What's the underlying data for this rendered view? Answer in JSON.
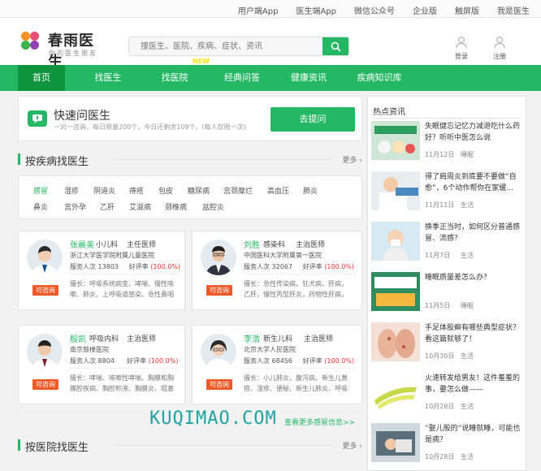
{
  "topbar": {
    "links": [
      "用户端App",
      "医生端App",
      "微信公众号",
      "企业版",
      "触屏版",
      "我是医生"
    ]
  },
  "logo": {
    "name": "春雨医生",
    "slogan": "你的医生朋友"
  },
  "search": {
    "placeholder": "搜医生、医院、疾病、症状、资讯"
  },
  "header": {
    "login": "登录",
    "register": "注册"
  },
  "nav": {
    "items": [
      "首页",
      "找医生",
      "找医院",
      "经典问答",
      "健康资讯",
      "疾病知识库"
    ],
    "new_badge": "NEW"
  },
  "quick": {
    "title": "快速问医生",
    "subtitle": "一对一咨询，每日限量200个，今日还剩余109个。(每人仅限一次)",
    "button": "去提问"
  },
  "disease_section": {
    "title": "按疾病找医生",
    "more": "更多"
  },
  "diseases": [
    "感冒",
    "湿疹",
    "阴道炎",
    "痔疮",
    "包皮",
    "糖尿病",
    "宫颈糜烂",
    "高血压",
    "肺炎",
    "鼻炎",
    "宫外孕",
    "乙肝",
    "艾滋病",
    "颈椎病",
    "盆腔炎"
  ],
  "doctors": [
    {
      "name": "张晨美",
      "dept": "小儿科",
      "title": "主任医师",
      "hospital": "浙江大学医学院附属儿童医院",
      "served_label": "服务人次",
      "served": "13803",
      "rate_label": "好评率",
      "rate": "(100.0%)",
      "skill": "擅长：呼吸系统病变、哮喘、慢性咳嗽、肺炎、上呼吸道感染、急性鼻咽炎",
      "consult": "可咨询"
    },
    {
      "name": "刘胜",
      "dept": "感染科",
      "title": "主治医师",
      "hospital": "中国医科大学附属第一医院",
      "served_label": "服务人次",
      "served": "32067",
      "rate_label": "好评率",
      "rate": "(100.0%)",
      "skill": "擅长：急性传染病，狂犬病，肝病，乙肝，慢性丙型肝炎，药物性肝病，",
      "consult": "可咨询"
    },
    {
      "name": "殷凯",
      "dept": "呼吸内科",
      "title": "主治医师",
      "hospital": "南京鼓楼医院",
      "served_label": "服务人次",
      "served": "8804",
      "rate_label": "好评率",
      "rate": "(100.0%)",
      "skill": "擅长：哮喘、咳嗽性哮喘、胸膜和胸膜腔疾病、胸腔积液、胸膜炎、阻塞性",
      "consult": "可咨询"
    },
    {
      "name": "李浩",
      "dept": "新生儿科",
      "title": "主治医师",
      "hospital": "北京大学人民医院",
      "served_label": "服务人次",
      "served": "68456",
      "rate_label": "好评率",
      "rate": "(100.0%)",
      "skill": "擅长：小儿肺炎、腹泻病、新生儿黄疸、湿疹、便秘、新生儿肺炎、呼吸",
      "consult": "可咨询"
    }
  ],
  "doctor_more": "查看更多感冒信息>>",
  "watermark": "KUQIMAO.COM",
  "hospital_section": {
    "title": "按医院找医生",
    "more": "更多"
  },
  "sidebar": {
    "title": "热点资讯",
    "news": [
      {
        "title": "失眠健忘记忆力减退吃什么药好？听听中医怎么说",
        "date": "11月12日",
        "cat": "睡眠"
      },
      {
        "title": "得了肩周炎到底要不要做“自愈”，6个动作帮你在家缓...",
        "date": "11月11日",
        "cat": "生活"
      },
      {
        "title": "换季正当时，如何区分普通感冒、流感？",
        "date": "11月7日",
        "cat": "生活"
      },
      {
        "title": "睡眠质量差怎么办？",
        "date": "11月5日",
        "cat": "睡眠"
      },
      {
        "title": "手足体股癣有哪些典型症状？看这篇就够了！",
        "date": "10月30日",
        "cat": "生活"
      },
      {
        "title": "火速转发给男友！这件羞羞的事，要怎么做——",
        "date": "10月28日",
        "cat": "生活"
      },
      {
        "title": "“娶儿般的”说睡就睡，可能也是病？",
        "date": "10月28日",
        "cat": "生活"
      }
    ]
  }
}
